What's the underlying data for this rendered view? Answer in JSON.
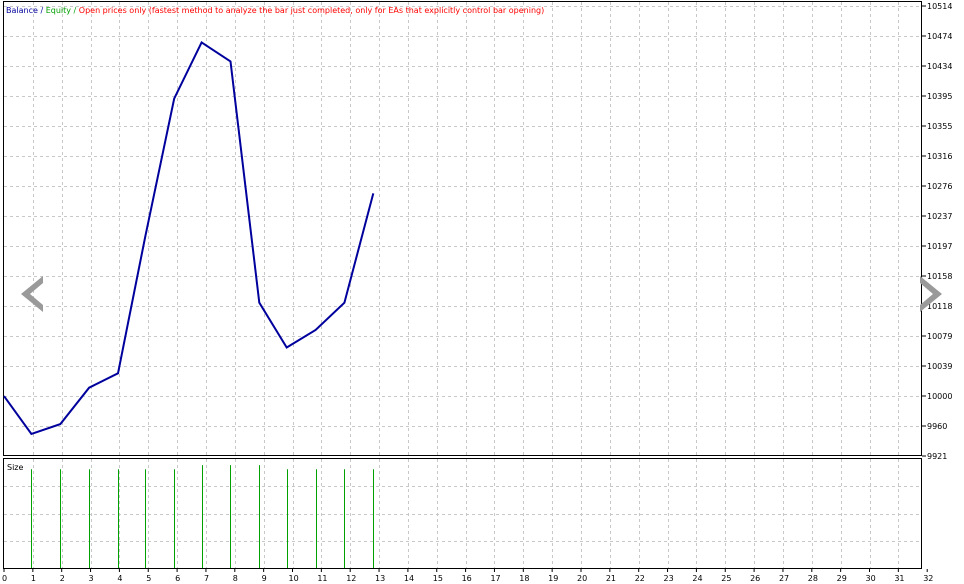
{
  "header": {
    "balance_label": "Balance",
    "sep1": " / ",
    "equity_label": "Equity",
    "sep2": " / ",
    "mode_text": "Open prices only (fastest method to analyze the bar just completed, only for EAs that explicitly control bar opening)"
  },
  "size_panel": {
    "label": "Size"
  },
  "nav": {
    "prev_icon": "triangle-left-icon",
    "next_icon": "triangle-right-icon"
  },
  "colors": {
    "balance": "#00009c",
    "equity": "#00a000",
    "mode_text": "#ff0000",
    "size_bars": "#00a000",
    "grid": "#c8c8c8",
    "axis": "#000000"
  },
  "chart_data": [
    {
      "type": "line",
      "series": [
        {
          "name": "Balance",
          "x": [
            0,
            0.95,
            1.95,
            2.95,
            3.95,
            4.9,
            5.9,
            6.85,
            7.85,
            8.85,
            9.8,
            10.8,
            11.8,
            12.8
          ],
          "values": [
            10000,
            9950,
            9963,
            10011,
            10030,
            10211,
            10392,
            10466,
            10441,
            10123,
            10064,
            10087,
            10123,
            10267
          ]
        }
      ],
      "y_ticks": [
        "10514",
        "10474",
        "10434",
        "10395",
        "10355",
        "10316",
        "10276",
        "10237",
        "10197",
        "10158",
        "10118",
        "10079",
        "10039",
        "10000",
        "9960",
        "9921"
      ],
      "ylim": [
        9921,
        10514
      ],
      "xlim": [
        0,
        32.5
      ],
      "grid": true
    },
    {
      "type": "bar",
      "title": "Size",
      "x": [
        0.95,
        1.95,
        2.95,
        3.95,
        4.9,
        5.9,
        6.85,
        7.85,
        8.85,
        9.8,
        10.8,
        11.8,
        12.8
      ],
      "values": [
        0.94,
        0.94,
        0.94,
        0.94,
        0.94,
        0.94,
        0.98,
        0.98,
        0.98,
        0.94,
        0.94,
        0.94,
        0.94
      ],
      "x_ticks": [
        "0",
        "1",
        "2",
        "3",
        "4",
        "5",
        "6",
        "7",
        "8",
        "9",
        "10",
        "11",
        "12",
        "13",
        "14",
        "15",
        "16",
        "17",
        "18",
        "19",
        "20",
        "21",
        "22",
        "23",
        "24",
        "25",
        "26",
        "27",
        "28",
        "29",
        "30",
        "31",
        "32"
      ],
      "ylim": [
        0,
        1
      ],
      "grid": true
    }
  ]
}
